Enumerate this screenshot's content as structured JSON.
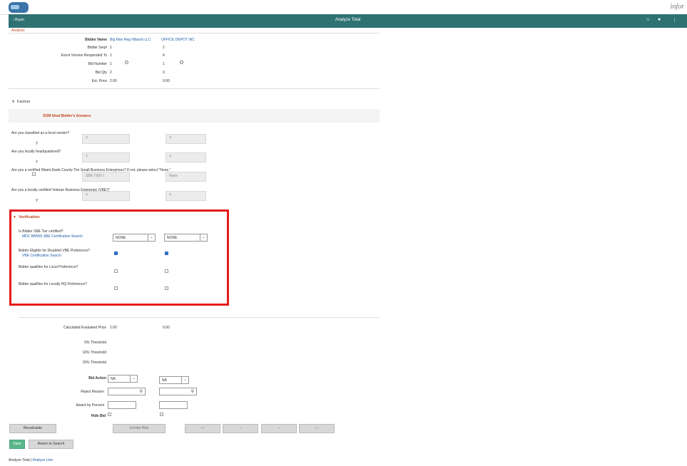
{
  "header": {
    "back_label": "‹ Buyer",
    "title": "Analyze Total",
    "brand": "infor",
    "home_icon": "home-icon",
    "chat_icon": "chat-icon",
    "menu_icon": "kebab-menu-icon"
  },
  "analysis": {
    "section_label": "Analysis",
    "rows": [
      {
        "label": "Bidder Name",
        "col1": "Big Man Reg Hibachi LLC",
        "col2": "OFFICE DEPOT INC"
      },
      {
        "label": "Bidder Seq#",
        "col1": "1",
        "col2": "2"
      },
      {
        "label": "Event Version Responded To",
        "col1": "1",
        "col2": "4"
      },
      {
        "label": "Bid Number",
        "col1": "1",
        "col2": "1"
      },
      {
        "label": "Bid Qty",
        "col1": "2",
        "col2": "3"
      },
      {
        "label": "Ext. Price",
        "col1": "2.00",
        "col2": "0.00"
      }
    ]
  },
  "factors": {
    "section_label": "Factors",
    "band_label": "SOM  Ideal Bidder's Answers",
    "questions": [
      {
        "question": "Are you classified as a local vendor?",
        "ideal": "Y",
        "col1": "Y",
        "col2": "Y"
      },
      {
        "question": "Are you locally headquartered?",
        "ideal": "Y",
        "col1": "Y",
        "col2": "Y"
      },
      {
        "question": "Are you a certified Miami-Dade County Tier Small Business Enterprises? If not, please select \"None.\"",
        "ideal": "",
        "col1": "SBE TIER 1",
        "col2": "None"
      },
      {
        "question": "Are you a locally certified Veteran Business Enterprise (VBE)?",
        "ideal": "Y",
        "col1": "Y",
        "col2": "Y"
      }
    ]
  },
  "verification": {
    "section_label": "Verification",
    "sbe_label": "Is Bidder SBE Tier certified?",
    "sbe_link": "MDC BMWS SBE Certification Search",
    "sbe_col1": "NONE",
    "sbe_col2": "NONE",
    "vbe_label": "Bidder Eligible for Disabled VBE Preference?",
    "vbe_link": "VBE Certification Search",
    "local_label": "Bidder qualifies for Local Preference?",
    "hq_label": "Bidder qualifies for Locally HQ Preference?",
    "vbe_checked": [
      true,
      true
    ],
    "local_checked": [
      false,
      false
    ],
    "hq_checked": [
      false,
      false
    ]
  },
  "evaluation": {
    "calc_label": "Calculated Evaluated Price",
    "calc_col1": "2.00",
    "calc_col2": "0.00",
    "thresholds": [
      "5% Threshold",
      "10% Threshold",
      "15% Threshold"
    ],
    "bid_action_label": "Bid Action",
    "bid_action_col1": "NA",
    "bid_action_col2": "NA",
    "reject_reason_label": "Reject Reason",
    "award_label": "Award by Percent",
    "hide_bid_label": "Hide Bid"
  },
  "buttons": {
    "recalculate": "Recalculate",
    "unhide": "Unhide Bids",
    "first": "<<",
    "prev": "<",
    "next": ">",
    "last": ">>",
    "save": "Save",
    "return": "Return to Search"
  },
  "footer": {
    "analyze_total": "Analyze Total",
    "sep": "|",
    "analyze_line": "Analyze Line"
  }
}
